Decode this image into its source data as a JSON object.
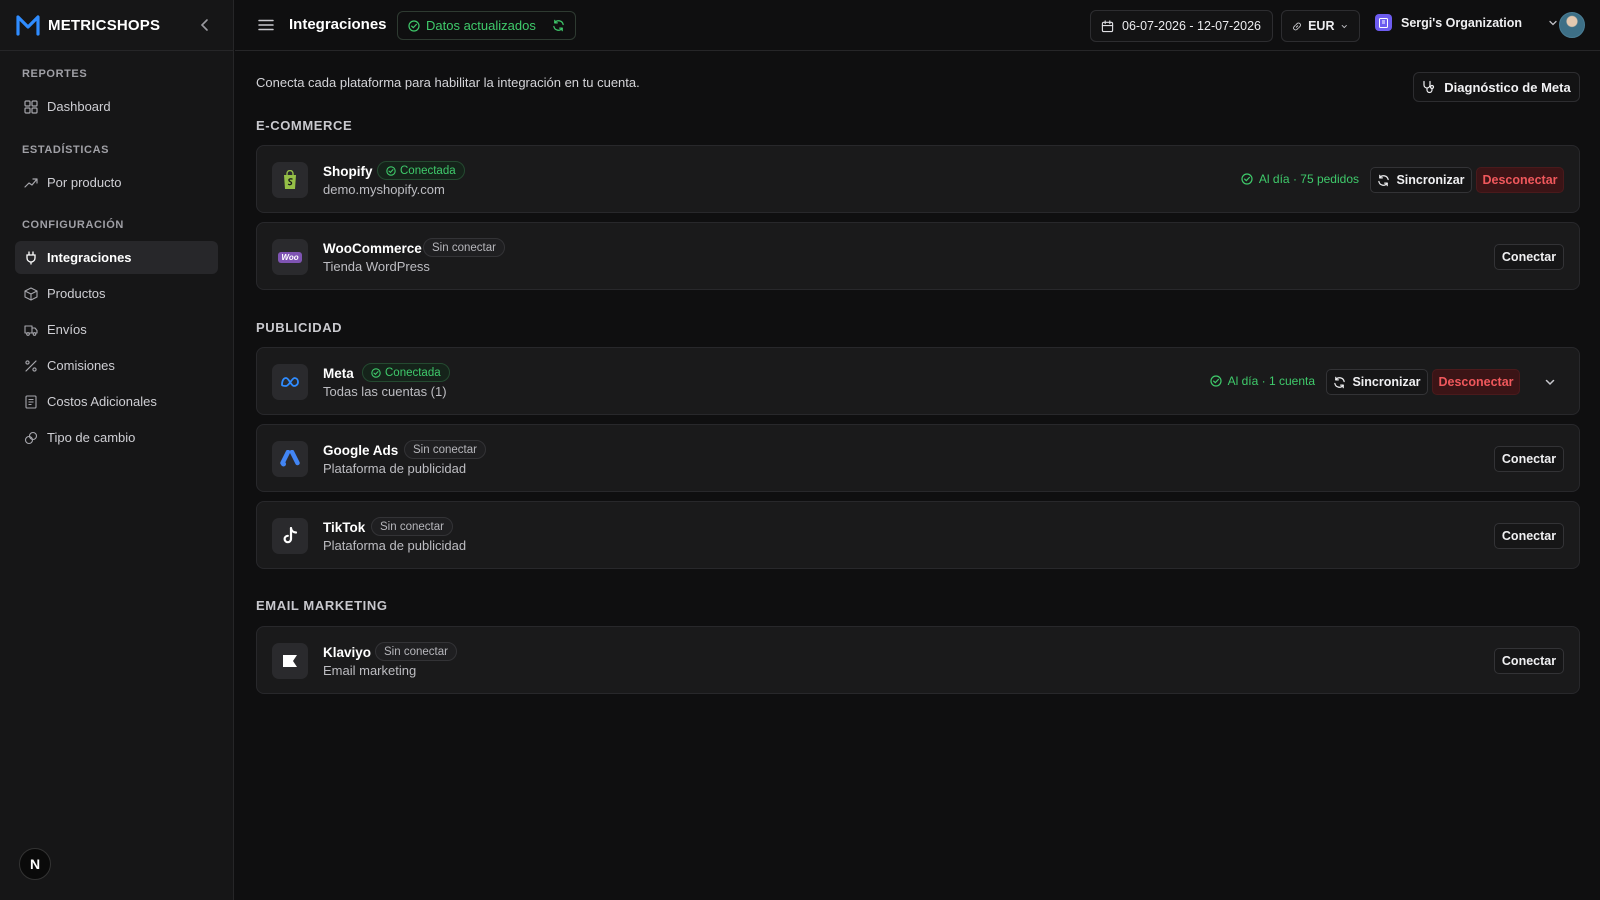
{
  "app": {
    "brand": "METRICSHOPS"
  },
  "sidebar": {
    "sections": [
      {
        "heading": "REPORTES",
        "items": [
          {
            "label": "Dashboard",
            "icon": "dashboard-icon"
          }
        ]
      },
      {
        "heading": "ESTADÍSTICAS",
        "items": [
          {
            "label": "Por producto",
            "icon": "trending-up-icon"
          }
        ]
      },
      {
        "heading": "CONFIGURACIÓN",
        "items": [
          {
            "label": "Integraciones",
            "icon": "plug-icon",
            "active": true
          },
          {
            "label": "Productos",
            "icon": "box-icon"
          },
          {
            "label": "Envíos",
            "icon": "truck-icon"
          },
          {
            "label": "Comisiones",
            "icon": "percent-icon"
          },
          {
            "label": "Costos Adicionales",
            "icon": "receipt-icon"
          },
          {
            "label": "Tipo de cambio",
            "icon": "exchange-icon"
          }
        ]
      }
    ],
    "footer_avatar": "N"
  },
  "topbar": {
    "title": "Integraciones",
    "status": "Datos actualizados",
    "date_range": "06-07-2026 - 12-07-2026",
    "currency": "EUR",
    "organization": "Sergi's Organization"
  },
  "main": {
    "intro": "Conecta cada plataforma para habilitar la integración en tu cuenta.",
    "diagnostic_button": "Diagnóstico de Meta",
    "sections": {
      "ecommerce": "E-COMMERCE",
      "publicidad": "PUBLICIDAD",
      "email": "EMAIL MARKETING"
    },
    "integrations": {
      "shopify": {
        "name": "Shopify",
        "badge": "Conectada",
        "desc": "demo.myshopify.com",
        "sync_status": "Al día · 75 pedidos",
        "sync_label": "Sincronizar",
        "disconnect_label": "Desconectar"
      },
      "woocommerce": {
        "name": "WooCommerce",
        "badge": "Sin conectar",
        "desc": "Tienda WordPress",
        "connect_label": "Conectar",
        "logo_text": "Woo"
      },
      "meta": {
        "name": "Meta",
        "badge": "Conectada",
        "desc": "Todas las cuentas (1)",
        "sync_status": "Al día · 1 cuenta",
        "sync_label": "Sincronizar",
        "disconnect_label": "Desconectar"
      },
      "google_ads": {
        "name": "Google Ads",
        "badge": "Sin conectar",
        "desc": "Plataforma de publicidad",
        "connect_label": "Conectar"
      },
      "tiktok": {
        "name": "TikTok",
        "badge": "Sin conectar",
        "desc": "Plataforma de publicidad",
        "connect_label": "Conectar"
      },
      "klaviyo": {
        "name": "Klaviyo",
        "badge": "Sin conectar",
        "desc": "Email marketing",
        "connect_label": "Conectar"
      }
    }
  },
  "colors": {
    "accent_green": "#3fca6b",
    "danger": "#f0585c",
    "brand_blue": "#2f8cff",
    "org_purple": "#6d5cf0"
  }
}
